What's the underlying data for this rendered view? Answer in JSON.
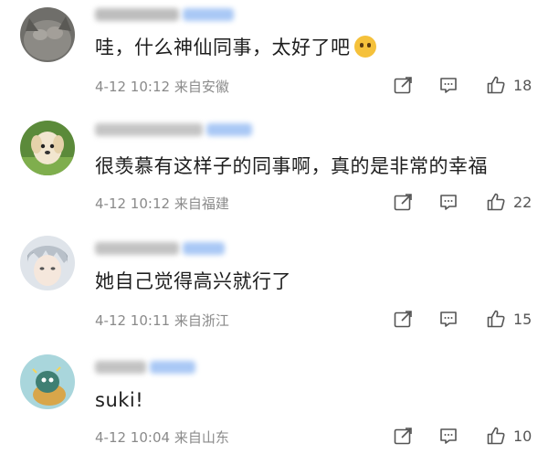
{
  "comments": [
    {
      "text": "哇，什么神仙同事，太好了吧",
      "emoji": "surprised-emoji",
      "time": "4-12 10:12",
      "location": "来自安徽",
      "likes": "18",
      "avatar": "cat-avatar"
    },
    {
      "text": "很羡慕有这样子的同事啊，真的是非常的幸福",
      "time": "4-12 10:12",
      "location": "来自福建",
      "likes": "22",
      "avatar": "puppy-avatar"
    },
    {
      "text": "她自己觉得高兴就行了",
      "time": "4-12 10:11",
      "location": "来自浙江",
      "likes": "15",
      "avatar": "anime-boy-avatar"
    },
    {
      "text": "suki!",
      "time": "4-12 10:04",
      "location": "来自山东",
      "likes": "10",
      "avatar": "cartoon-avatar"
    }
  ],
  "colors": {
    "text": "#1e1e1e",
    "meta": "#8a8a8a",
    "blurred_name": "#c9c9c9",
    "blurred_badge": "#a9c8f5"
  }
}
